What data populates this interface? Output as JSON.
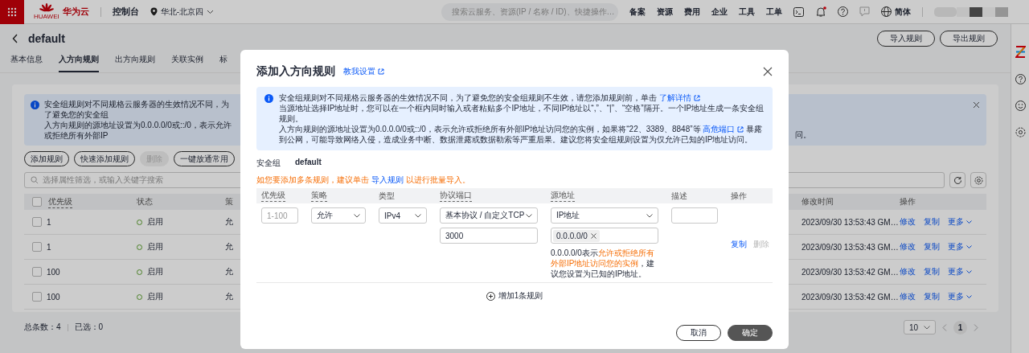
{
  "top_bar": {
    "logo_caption": "HUAWEI",
    "brand": "华为云",
    "console": "控制台",
    "region": "华北-北京四",
    "search": {
      "placeholder": "搜索云服务、资源(IP / 名称 / ID)、快捷操作…"
    },
    "menu": [
      "备案",
      "资源",
      "费用",
      "企业",
      "工具",
      "工单"
    ],
    "notifications_unread": true,
    "language": "简体"
  },
  "page": {
    "title": "default",
    "header_buttons": [
      "导入规则",
      "导出规则"
    ],
    "tabs": [
      {
        "label": "基本信息",
        "selected": false
      },
      {
        "label": "入方向规则",
        "selected": true
      },
      {
        "label": "出方向规则",
        "selected": false
      },
      {
        "label": "关联实例",
        "selected": false
      },
      {
        "label": "标",
        "selected": false
      }
    ]
  },
  "rules_panel": {
    "alert": {
      "left_lines": [
        "安全组规则对不同规格云服务器的生效情况不同，为了避免您的安全组",
        "入方向规则的源地址设置为0.0.0.0/0或::/0，表示允许或拒绝所有外部IP"
      ],
      "right_fragment": "问。"
    },
    "toolbar": [
      {
        "label": "添加规则",
        "disabled": false
      },
      {
        "label": "快速添加规则",
        "disabled": false
      },
      {
        "label": "删除",
        "disabled": true
      },
      {
        "label": "一键放通常用",
        "disabled": false
      }
    ],
    "search": {
      "placeholder": "选择属性筛选，或输入关键字搜索"
    },
    "select_all": {
      "checked": false
    },
    "columns_left": [
      "优先级",
      "状态",
      "策"
    ],
    "columns_right": [
      "修改时间",
      "操作"
    ],
    "rows": [
      {
        "checked": false,
        "priority": "1",
        "status": "启用",
        "policy": "允",
        "modified": "2023/09/30 13:53:43 GM…",
        "actions": [
          "修改",
          "复制",
          "更多"
        ]
      },
      {
        "checked": false,
        "priority": "1",
        "status": "启用",
        "policy": "允",
        "modified": "2023/09/30 13:53:43 GM…",
        "actions": [
          "修改",
          "复制",
          "更多"
        ]
      },
      {
        "checked": false,
        "priority": "100",
        "status": "启用",
        "policy": "允",
        "modified": "2023/09/30 13:53:42 GM…",
        "actions": [
          "修改",
          "复制",
          "更多"
        ]
      },
      {
        "checked": false,
        "priority": "100",
        "status": "启用",
        "policy": "允",
        "modified": "2023/09/30 13:53:42 GM…",
        "actions": [
          "修改",
          "复制",
          "更多"
        ]
      }
    ],
    "footer": {
      "total": "总条数：4",
      "selected_count": "已选：0",
      "page_size": "10",
      "pages": [
        {
          "label": "1",
          "selected": true
        }
      ]
    }
  },
  "dialog": {
    "title": "添加入方向规则",
    "help_link": "教我设置",
    "info_lines": [
      [
        {
          "text": "安全组规则对不同规格云服务器的生效情况不同，为了避免您的安全组规则不生效，请您添加规则前，单击 ",
          "kind": "text"
        },
        {
          "text": "了解详情",
          "kind": "link",
          "external": true
        }
      ],
      [
        {
          "text": "当源地址选择IP地址时，您可以在一个框内同时输入或者粘贴多个IP地址，不同IP地址以“,”、“|”、“空格”隔开。一个IP地址生成一条安全组规则。",
          "kind": "text"
        }
      ],
      [
        {
          "text": "入方向规则的源地址设置为0.0.0.0/0或::/0，表示允许或拒绝所有外部IP地址访问您的实例，如果将“22、3389、8848”等 ",
          "kind": "text"
        },
        {
          "text": "高危端口",
          "kind": "link",
          "external": true
        },
        {
          "text": " 暴露到公网，可能导致网络入侵，造成业务中断、数据泄露或数据勒索等严重后果。建议您将安全组规则设置为仅允许已知的IP地址访问。",
          "kind": "text"
        }
      ]
    ],
    "security_group": {
      "label": "安全组",
      "value": "default"
    },
    "bulk_hint": [
      {
        "text": "如您要添加多条规则，建议单击 ",
        "kind": "warning"
      },
      {
        "text": "导入规则",
        "kind": "link"
      },
      {
        "text": " 以进行批量导入。",
        "kind": "warning"
      }
    ],
    "columns": [
      {
        "label": "优先级",
        "tip": true
      },
      {
        "label": "策略",
        "tip": true
      },
      {
        "label": "类型",
        "tip": false
      },
      {
        "label": "协议端口",
        "tip": true
      },
      {
        "label": "源地址",
        "tip": true
      },
      {
        "label": "描述",
        "tip": false
      },
      {
        "label": "操作",
        "tip": false
      }
    ],
    "rule": {
      "priority": {
        "placeholder": "1-100"
      },
      "policy": "允许",
      "type": "IPv4",
      "protocol": "基本协议 / 自定义TCP",
      "port": "3000",
      "source_type": "IP地址",
      "source_tags": [
        "0.0.0.0/0"
      ],
      "source_note": [
        {
          "text": "0.0.0.0/0表示",
          "kind": "text"
        },
        {
          "text": "允许或拒绝所有外部IP地址访问您的实例",
          "kind": "warning"
        },
        {
          "text": "，建议您设置为已知的IP地址。",
          "kind": "text"
        }
      ],
      "actions": [
        {
          "label": "复制",
          "disabled": false
        },
        {
          "label": "删除",
          "disabled": true
        }
      ]
    },
    "add_rule": "增加1条规则",
    "buttons": [
      {
        "label": "取消",
        "kind": "secondary"
      },
      {
        "label": "确定",
        "kind": "primary"
      }
    ]
  }
}
